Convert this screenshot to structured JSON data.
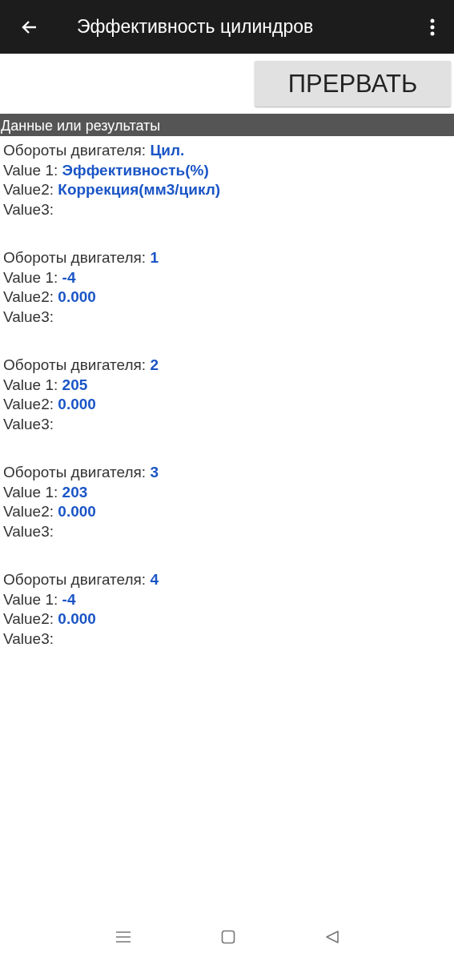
{
  "app_bar": {
    "title": "Эффективность цилиндров"
  },
  "action_button": {
    "label": "ПРЕРВАТЬ"
  },
  "section": {
    "title": "Данные или результаты"
  },
  "groups": [
    {
      "lines": [
        {
          "label": "Обороты двигателя:",
          "value": "Цил."
        },
        {
          "label": "Value 1:",
          "value": "Эффективность(%)"
        },
        {
          "label": "Value2:",
          "value": "Коррекция(мм3/цикл)"
        },
        {
          "label": "Value3:"
        }
      ]
    },
    {
      "lines": [
        {
          "label": "Обороты двигателя:",
          "value": "1"
        },
        {
          "label": "Value 1:",
          "value": "-4"
        },
        {
          "label": "Value2:",
          "value": "0.000"
        },
        {
          "label": "Value3:"
        }
      ]
    },
    {
      "lines": [
        {
          "label": "Обороты двигателя:",
          "value": "2"
        },
        {
          "label": "Value 1:",
          "value": "205"
        },
        {
          "label": "Value2:",
          "value": "0.000"
        },
        {
          "label": "Value3:"
        }
      ]
    },
    {
      "lines": [
        {
          "label": "Обороты двигателя:",
          "value": "3"
        },
        {
          "label": "Value 1:",
          "value": "203"
        },
        {
          "label": "Value2:",
          "value": "0.000"
        },
        {
          "label": "Value3:"
        }
      ]
    },
    {
      "lines": [
        {
          "label": "Обороты двигателя:",
          "value": "4"
        },
        {
          "label": "Value 1:",
          "value": "-4"
        },
        {
          "label": "Value2:",
          "value": "0.000"
        },
        {
          "label": "Value3:"
        }
      ]
    }
  ]
}
